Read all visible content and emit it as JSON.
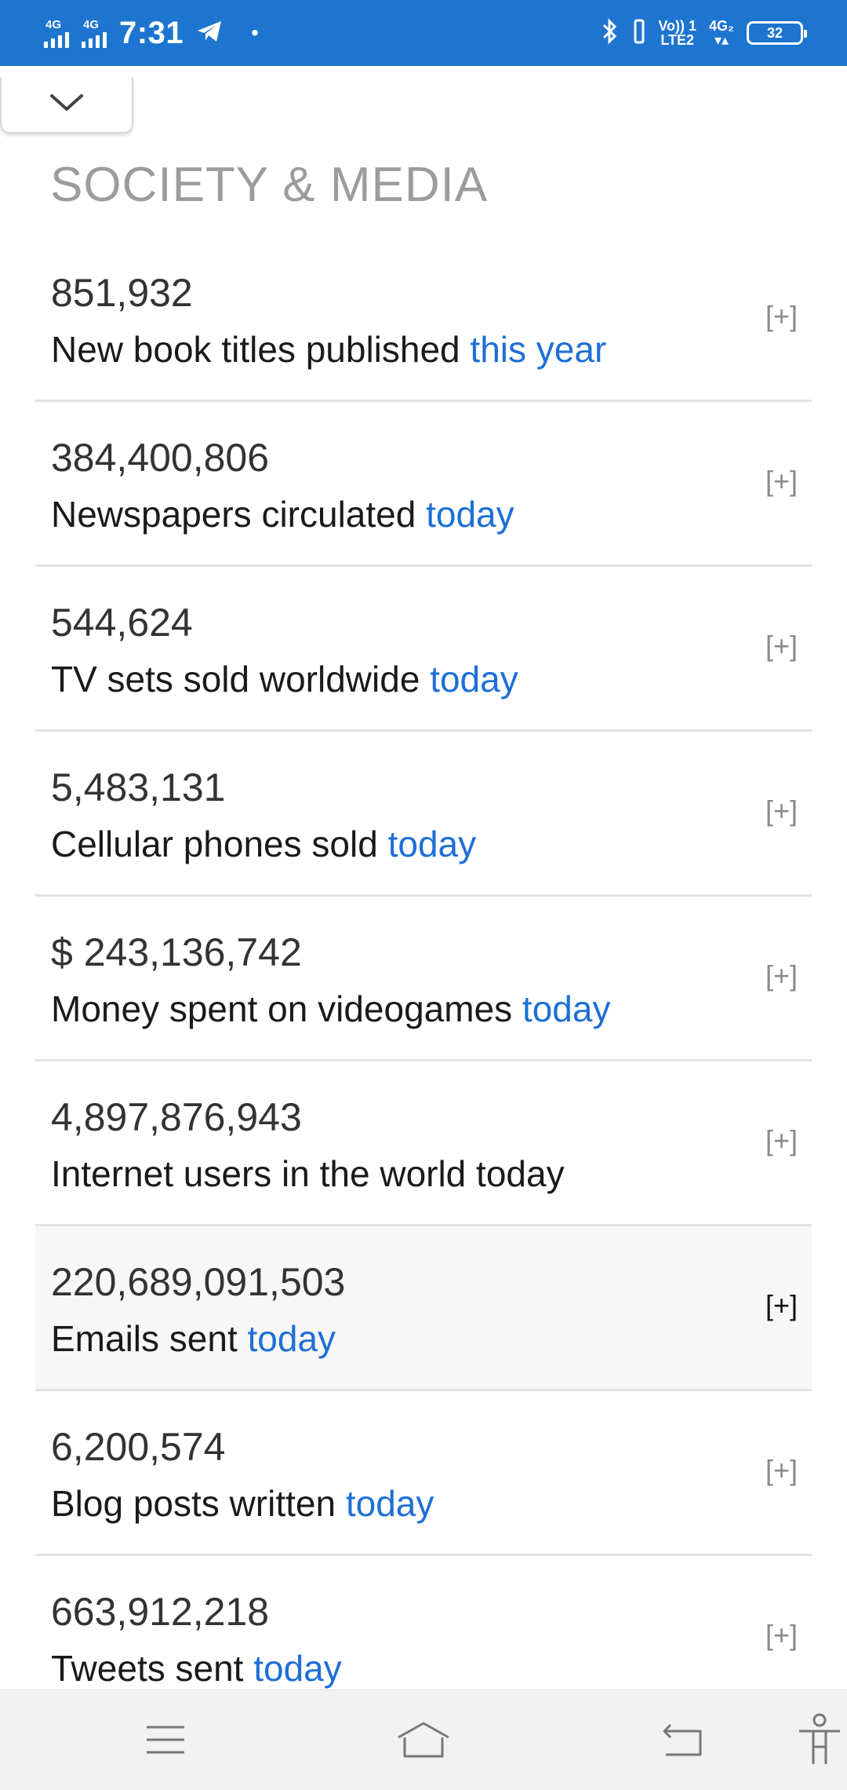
{
  "status_bar": {
    "sim1": "4G",
    "sim2": "4G",
    "time": "7:31",
    "dot": "•",
    "volte_top": "Vo)) 1",
    "volte_bottom": "LTE2",
    "net_top": "4G₂",
    "battery": "32"
  },
  "page": {
    "title": "SOCIETY & MEDIA",
    "expand_label": "[+]"
  },
  "items": [
    {
      "value": "851,932",
      "label": "New book titles published ",
      "period": "this year"
    },
    {
      "value": "384,400,806",
      "label": "Newspapers circulated ",
      "period": "today"
    },
    {
      "value": "544,624",
      "label": "TV sets sold worldwide ",
      "period": "today"
    },
    {
      "value": "5,483,131",
      "label": "Cellular phones sold ",
      "period": "today"
    },
    {
      "value": "$ 243,136,742",
      "label": "Money spent on videogames ",
      "period": "today"
    },
    {
      "value": "4,897,876,943",
      "label": "Internet users in the world today",
      "period": ""
    },
    {
      "value": "220,689,091,503",
      "label": "Emails sent ",
      "period": "today"
    },
    {
      "value": "6,200,574",
      "label": "Blog posts written ",
      "period": "today"
    },
    {
      "value": "663,912,218",
      "label": "Tweets sent ",
      "period": "today"
    }
  ],
  "colors": {
    "status_bar": "#1e75d0",
    "accent_link": "#1e6fd6",
    "title_gray": "#9c9c9c"
  }
}
